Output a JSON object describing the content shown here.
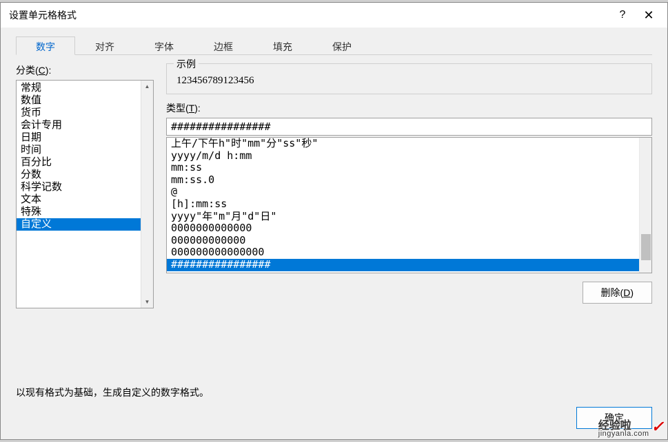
{
  "dialog": {
    "title": "设置单元格格式",
    "help_symbol": "?",
    "close_symbol": "✕"
  },
  "tabs": [
    {
      "label": "数字",
      "active": true
    },
    {
      "label": "对齐",
      "active": false
    },
    {
      "label": "字体",
      "active": false
    },
    {
      "label": "边框",
      "active": false
    },
    {
      "label": "填充",
      "active": false
    },
    {
      "label": "保护",
      "active": false
    }
  ],
  "category": {
    "label_prefix": "分类(",
    "label_key": "C",
    "label_suffix": "):",
    "items": [
      {
        "label": "常规",
        "selected": false
      },
      {
        "label": "数值",
        "selected": false
      },
      {
        "label": "货币",
        "selected": false
      },
      {
        "label": "会计专用",
        "selected": false
      },
      {
        "label": "日期",
        "selected": false
      },
      {
        "label": "时间",
        "selected": false
      },
      {
        "label": "百分比",
        "selected": false
      },
      {
        "label": "分数",
        "selected": false
      },
      {
        "label": "科学记数",
        "selected": false
      },
      {
        "label": "文本",
        "selected": false
      },
      {
        "label": "特殊",
        "selected": false
      },
      {
        "label": "自定义",
        "selected": true
      }
    ]
  },
  "sample": {
    "group_label": "示例",
    "value": "123456789123456"
  },
  "type": {
    "label_prefix": "类型(",
    "label_key": "T",
    "label_suffix": "):",
    "input_value": "################",
    "items": [
      {
        "label": "上午/下午h\"时\"mm\"分\"ss\"秒\"",
        "selected": false
      },
      {
        "label": "yyyy/m/d h:mm",
        "selected": false
      },
      {
        "label": "mm:ss",
        "selected": false
      },
      {
        "label": "mm:ss.0",
        "selected": false
      },
      {
        "label": "@",
        "selected": false
      },
      {
        "label": "[h]:mm:ss",
        "selected": false
      },
      {
        "label": "yyyy\"年\"m\"月\"d\"日\"",
        "selected": false
      },
      {
        "label": "0000000000000",
        "selected": false
      },
      {
        "label": "000000000000",
        "selected": false
      },
      {
        "label": "000000000000000",
        "selected": false
      },
      {
        "label": "################",
        "selected": true
      }
    ]
  },
  "buttons": {
    "delete_prefix": "删除(",
    "delete_key": "D",
    "delete_suffix": ")",
    "ok": "确定"
  },
  "hint": "以现有格式为基础，生成自定义的数字格式。",
  "watermark": {
    "main": "经验啦",
    "sub": "jingyanla.com",
    "check": "✓"
  },
  "scroll_arrows": {
    "up": "▲",
    "down": "▼"
  }
}
